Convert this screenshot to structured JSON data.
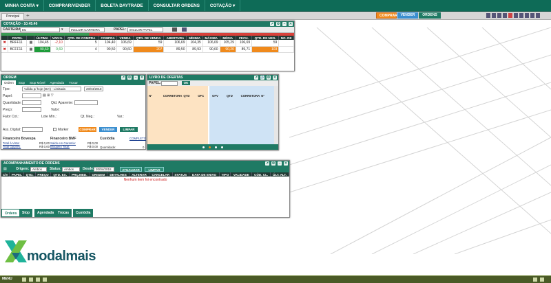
{
  "nav": {
    "items": [
      "MINHA CONTA ▾",
      "COMPRAR/VENDER",
      "BOLETA DAYTRADE",
      "CONSULTAR ORDENS",
      "COTAÇÃO ▾"
    ],
    "page_tab": "Principal",
    "pills": {
      "comprar": "COMPRAR",
      "vender": "VENDER",
      "ordens": "ORDENS"
    }
  },
  "cotacao": {
    "title": "COTAÇÃO - 10:45:46",
    "carteira_label": "CARTEIRA:",
    "carteira_value": "EU",
    "incluir_carteira": "INCLUIR CARTEIRA",
    "papel_label": "PAPEL:",
    "incluir_papel": "INCLUIR PAPEL",
    "columns": [
      "",
      "PAPEL",
      "",
      "ÚLTIMA",
      "VAR.%",
      "QTD. DE COMPRA",
      "COMPRA",
      "VENDA",
      "QTD. DE VENDA",
      "ABERTURA",
      "MÍNIMA",
      "MÁXIMA",
      "MÉDIA",
      "FECH.",
      "QTD. DE NEG.",
      "NO. DE"
    ],
    "rows": [
      {
        "papel": "BRFF11",
        "ultima": "104,45",
        "var": "-2,10",
        "qtd_compra": "5",
        "compra": "104,40",
        "venda": "106,69",
        "qtd_venda": "59",
        "abertura": "106,69",
        "minima": "104,35",
        "maxima": "106,69",
        "media": "105,29",
        "fech": "106,69",
        "qtd_neg": "59"
      },
      {
        "papel": "BCFF11",
        "ultima": "90,60",
        "var": "0,69",
        "qtd_compra": "4",
        "compra": "90,50",
        "venda": "90,60",
        "qtd_venda": "207",
        "abertura": "89,50",
        "minima": "89,93",
        "maxima": "90,60",
        "media": "90,20",
        "fech": "89,71",
        "qtd_neg": "103"
      }
    ]
  },
  "ordem": {
    "title": "ORDEM",
    "tabs": [
      "Ordem",
      "Stop",
      "Stop Móvel",
      "Agendada",
      "Trocar"
    ],
    "tipo_label": "Tipo:",
    "tipo_value": "Válida p/ hoje (DIA) - Limitada",
    "date_value": "20/04/2018",
    "papel_label": "Papel:",
    "quantidade_label": "Quantidade:",
    "qtd_aparente_label": "Qtd. Aparente:",
    "preco_label": "Preço:",
    "valor_label": "Valor:",
    "fator_label": "Fator Cot.:",
    "lote_label": "Lote Mín.:",
    "qt_neg_label": "Qt. Neg.:",
    "var_label": "Var.:",
    "ass_label": "Ass. Digital:",
    "marker_label": "Marker",
    "btn_comprar": "COMPRAR",
    "btn_vender": "VENDER",
    "btn_limpar": "LIMPAR",
    "fin_bovespa": "Financeiro Bovespa",
    "fin_bmf": "Financeiro BMF",
    "custodia": "Custódia",
    "completo": "COMPLETO",
    "total_vista": "Total à Vista:",
    "total_opcoes": "Total Opções:",
    "conta_margem": "Conta Margem:",
    "saldo_garantia": "Saldo em Garantia:",
    "bloqueio_total": "Bloqueio Total:",
    "limite_oper": "Limite Oper.:",
    "quantidade2": "Quantidade:",
    "zero_money": "R$ 0,00",
    "zero": "0"
  },
  "livro": {
    "title": "LIVRO DE OFERTAS",
    "papel_label": "PAPEL:",
    "ok": "OK",
    "columns": [
      "Nº",
      "CORRETORA",
      "QTD",
      "OFC",
      "OFV",
      "QTD",
      "CORRETORA",
      "Nº"
    ]
  },
  "acompanhamento": {
    "title": "ACOMPANHAMENTO DE ORDENS",
    "origem_label": "Origem:",
    "origem_value": "Ambos",
    "status_label": "Status:",
    "status_value": "Ambos",
    "desde_label": "Desde:",
    "desde_value": "20/04/2018",
    "btn_atualizar": "ATUALIZAR",
    "btn_limpar": "LIMPAR",
    "columns": [
      "C/V",
      "PAPEL",
      "QTD.",
      "PREÇO",
      "QTD. EX.",
      "PRÇ.MED.",
      "ORIGEM",
      "DETALHES",
      "ALTERAR",
      "CANCELAR",
      "STATUS",
      "DATA DE ENVIO",
      "TIPO",
      "VALIDADE",
      "CÓD. CL.",
      "ÚLT. ALT."
    ],
    "empty": "Nenhum item foi encontrado",
    "bottom_tabs": [
      "Ordens",
      "Stop",
      "Agendada",
      "Trocas",
      "Custódia"
    ]
  },
  "brand": {
    "name": "modalmais"
  },
  "taskbar": {
    "menu": "MENU"
  },
  "colors": {
    "green": "#1f7a64",
    "orange": "#f08a1c",
    "blue": "#3b8fd0",
    "dark_header": "#223a34"
  }
}
